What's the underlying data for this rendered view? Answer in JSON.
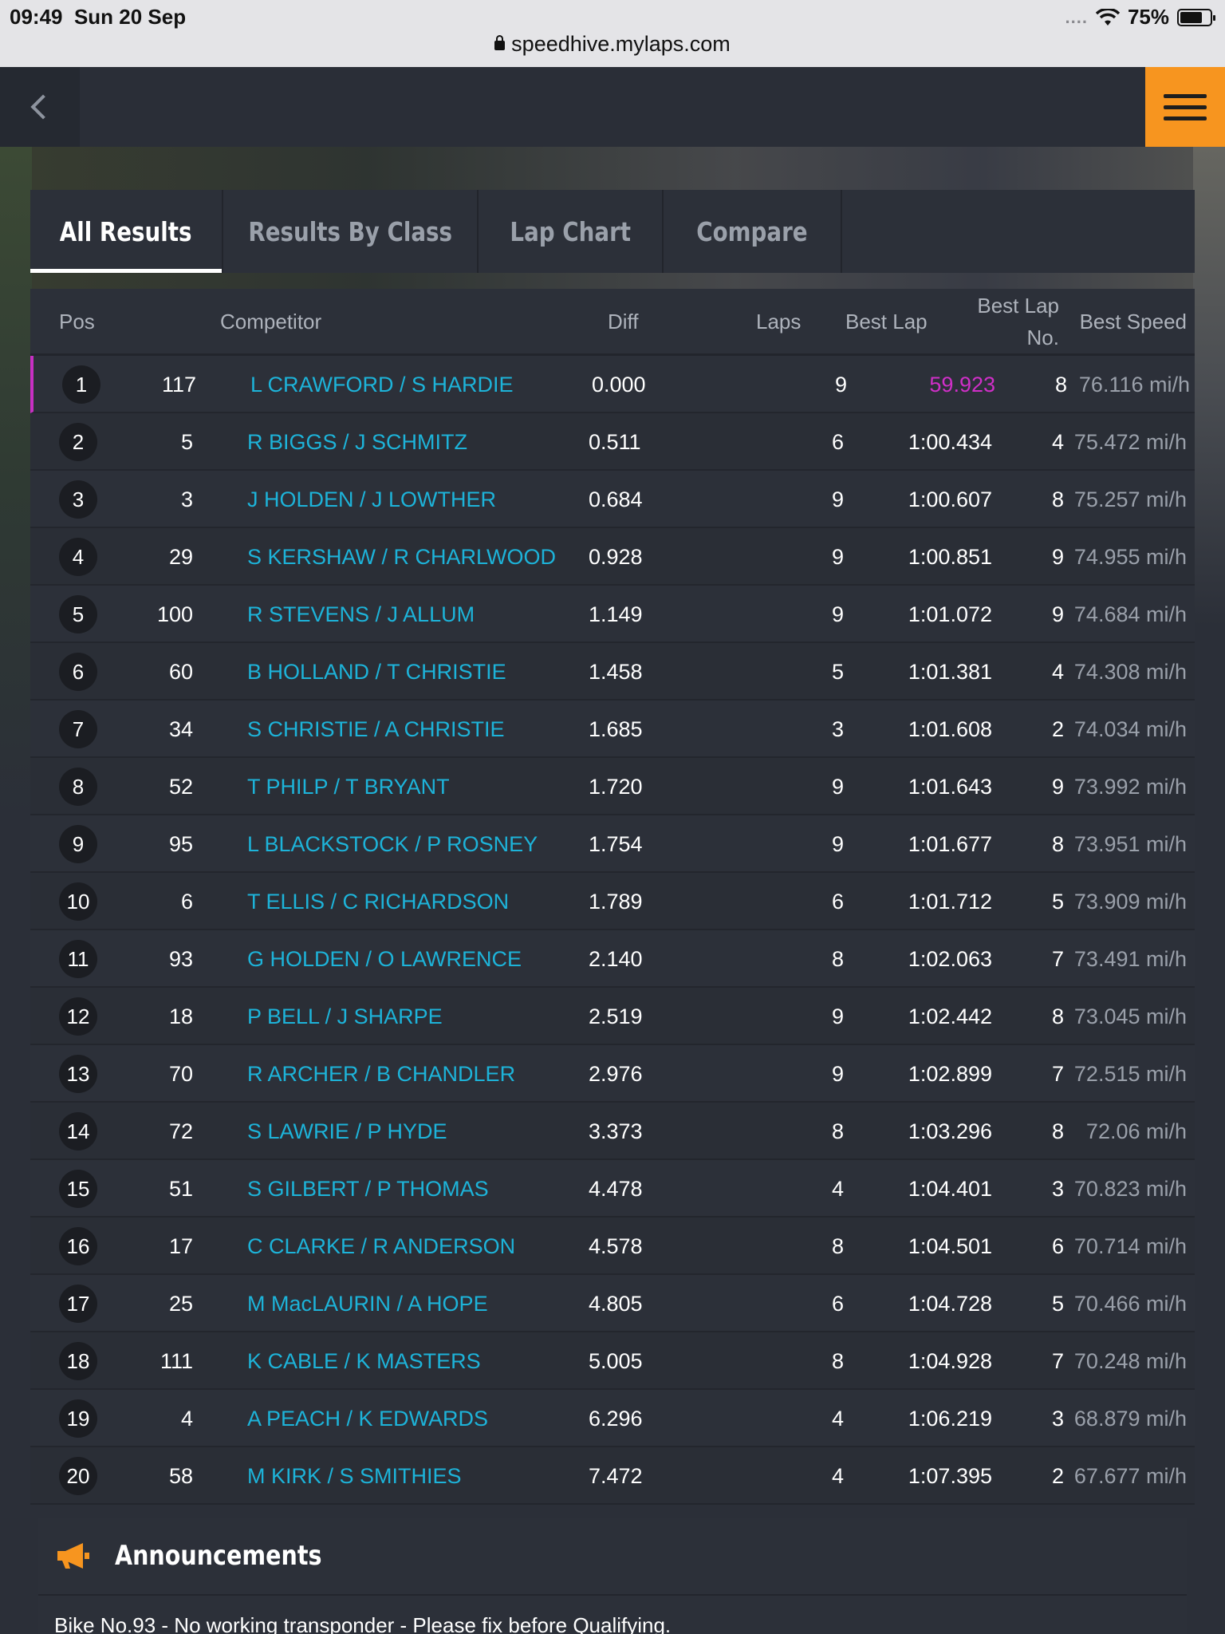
{
  "status_bar": {
    "time": "09:49",
    "date": "Sun 20 Sep",
    "signal_dots": "....",
    "battery_percent": "75%",
    "battery_level": 0.75
  },
  "browser": {
    "url": "speedhive.mylaps.com"
  },
  "header": {
    "back_icon": "chevron-left-icon",
    "menu_icon": "hamburger-menu-icon",
    "accent_color": "#f7951f"
  },
  "tabs": [
    {
      "label": "All Results",
      "active": true
    },
    {
      "label": "Results By Class",
      "active": false
    },
    {
      "label": "Lap Chart",
      "active": false
    },
    {
      "label": "Compare",
      "active": false
    }
  ],
  "table": {
    "headers": {
      "pos": "Pos",
      "competitor": "Competitor",
      "diff": "Diff",
      "laps": "Laps",
      "best_lap": "Best Lap",
      "best_lap_no_1": "Best Lap",
      "best_lap_no_2": "No.",
      "best_speed": "Best Speed"
    },
    "rows": [
      {
        "pos": "1",
        "num": "117",
        "competitor": "L CRAWFORD / S HARDIE",
        "diff": "0.000",
        "laps": "9",
        "best_lap": "59.923",
        "best_lap_no": "8",
        "best_speed": "76.116 mi/h"
      },
      {
        "pos": "2",
        "num": "5",
        "competitor": "R BIGGS / J SCHMITZ",
        "diff": "0.511",
        "laps": "6",
        "best_lap": "1:00.434",
        "best_lap_no": "4",
        "best_speed": "75.472 mi/h"
      },
      {
        "pos": "3",
        "num": "3",
        "competitor": "J HOLDEN / J LOWTHER",
        "diff": "0.684",
        "laps": "9",
        "best_lap": "1:00.607",
        "best_lap_no": "8",
        "best_speed": "75.257 mi/h"
      },
      {
        "pos": "4",
        "num": "29",
        "competitor": "S KERSHAW / R CHARLWOOD",
        "diff": "0.928",
        "laps": "9",
        "best_lap": "1:00.851",
        "best_lap_no": "9",
        "best_speed": "74.955 mi/h"
      },
      {
        "pos": "5",
        "num": "100",
        "competitor": "R STEVENS / J ALLUM",
        "diff": "1.149",
        "laps": "9",
        "best_lap": "1:01.072",
        "best_lap_no": "9",
        "best_speed": "74.684 mi/h"
      },
      {
        "pos": "6",
        "num": "60",
        "competitor": "B HOLLAND / T CHRISTIE",
        "diff": "1.458",
        "laps": "5",
        "best_lap": "1:01.381",
        "best_lap_no": "4",
        "best_speed": "74.308 mi/h"
      },
      {
        "pos": "7",
        "num": "34",
        "competitor": "S CHRISTIE / A CHRISTIE",
        "diff": "1.685",
        "laps": "3",
        "best_lap": "1:01.608",
        "best_lap_no": "2",
        "best_speed": "74.034 mi/h"
      },
      {
        "pos": "8",
        "num": "52",
        "competitor": "T PHILP / T BRYANT",
        "diff": "1.720",
        "laps": "9",
        "best_lap": "1:01.643",
        "best_lap_no": "9",
        "best_speed": "73.992 mi/h"
      },
      {
        "pos": "9",
        "num": "95",
        "competitor": "L BLACKSTOCK / P ROSNEY",
        "diff": "1.754",
        "laps": "9",
        "best_lap": "1:01.677",
        "best_lap_no": "8",
        "best_speed": "73.951 mi/h"
      },
      {
        "pos": "10",
        "num": "6",
        "competitor": "T ELLIS / C RICHARDSON",
        "diff": "1.789",
        "laps": "6",
        "best_lap": "1:01.712",
        "best_lap_no": "5",
        "best_speed": "73.909 mi/h"
      },
      {
        "pos": "11",
        "num": "93",
        "competitor": "G HOLDEN / O LAWRENCE",
        "diff": "2.140",
        "laps": "8",
        "best_lap": "1:02.063",
        "best_lap_no": "7",
        "best_speed": "73.491 mi/h"
      },
      {
        "pos": "12",
        "num": "18",
        "competitor": "P BELL / J SHARPE",
        "diff": "2.519",
        "laps": "9",
        "best_lap": "1:02.442",
        "best_lap_no": "8",
        "best_speed": "73.045 mi/h"
      },
      {
        "pos": "13",
        "num": "70",
        "competitor": "R ARCHER / B CHANDLER",
        "diff": "2.976",
        "laps": "9",
        "best_lap": "1:02.899",
        "best_lap_no": "7",
        "best_speed": "72.515 mi/h"
      },
      {
        "pos": "14",
        "num": "72",
        "competitor": "S LAWRIE / P HYDE",
        "diff": "3.373",
        "laps": "8",
        "best_lap": "1:03.296",
        "best_lap_no": "8",
        "best_speed": "72.06 mi/h"
      },
      {
        "pos": "15",
        "num": "51",
        "competitor": "S GILBERT / P THOMAS",
        "diff": "4.478",
        "laps": "4",
        "best_lap": "1:04.401",
        "best_lap_no": "3",
        "best_speed": "70.823 mi/h"
      },
      {
        "pos": "16",
        "num": "17",
        "competitor": "C CLARKE / R ANDERSON",
        "diff": "4.578",
        "laps": "8",
        "best_lap": "1:04.501",
        "best_lap_no": "6",
        "best_speed": "70.714 mi/h"
      },
      {
        "pos": "17",
        "num": "25",
        "competitor": "M MacLAURIN / A HOPE",
        "diff": "4.805",
        "laps": "6",
        "best_lap": "1:04.728",
        "best_lap_no": "5",
        "best_speed": "70.466 mi/h"
      },
      {
        "pos": "18",
        "num": "111",
        "competitor": "K CABLE / K MASTERS",
        "diff": "5.005",
        "laps": "8",
        "best_lap": "1:04.928",
        "best_lap_no": "7",
        "best_speed": "70.248 mi/h"
      },
      {
        "pos": "19",
        "num": "4",
        "competitor": "A PEACH / K EDWARDS",
        "diff": "6.296",
        "laps": "4",
        "best_lap": "1:06.219",
        "best_lap_no": "3",
        "best_speed": "68.879 mi/h"
      },
      {
        "pos": "20",
        "num": "58",
        "competitor": "M KIRK / S SMITHIES",
        "diff": "7.472",
        "laps": "4",
        "best_lap": "1:07.395",
        "best_lap_no": "2",
        "best_speed": "67.677 mi/h"
      }
    ],
    "colors": {
      "competitor": "#1db3d9",
      "fastest_lap": "#d02fc8",
      "leader_marker": "#c72fc3"
    }
  },
  "announcements": {
    "icon": "megaphone-icon",
    "title": "Announcements",
    "text": "Bike No.93 - No working transponder - Please fix before Qualifying."
  }
}
